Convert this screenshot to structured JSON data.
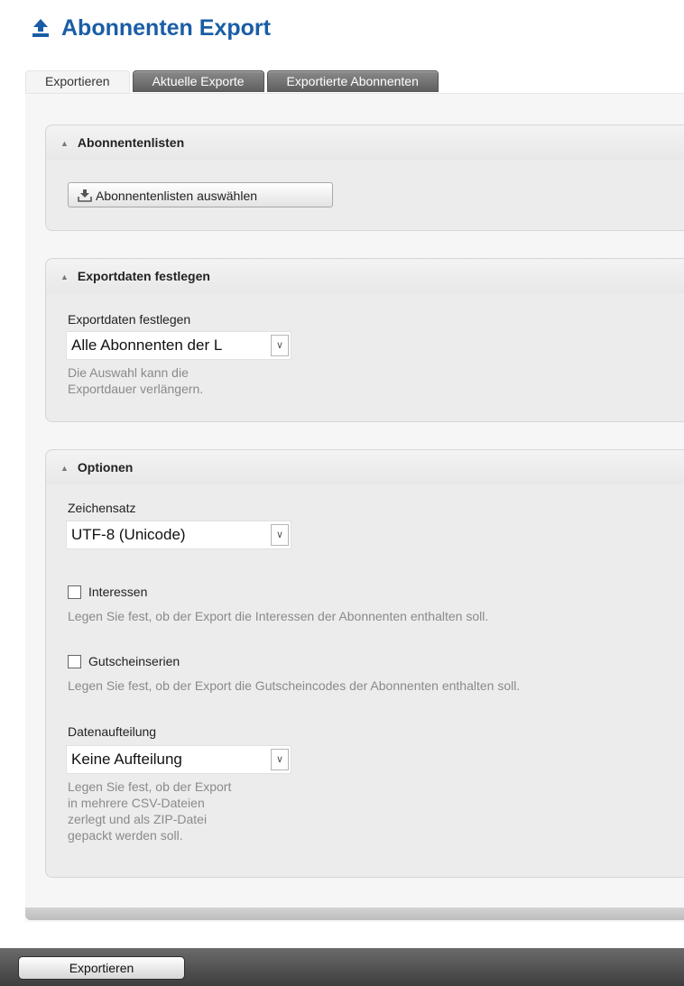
{
  "page": {
    "title": "Abonnenten Export",
    "title_icon": "upload-icon"
  },
  "tabs": [
    {
      "label": "Exportieren",
      "active": true
    },
    {
      "label": "Aktuelle Exporte",
      "active": false
    },
    {
      "label": "Exportierte Abonnenten",
      "active": false
    }
  ],
  "panels": {
    "lists": {
      "header": "Abonnentenlisten",
      "button_label": "Abonnentenlisten auswählen"
    },
    "exportdata": {
      "header": "Exportdaten festlegen",
      "field_label": "Exportdaten festlegen",
      "select_value": "Alle Abonnenten der L",
      "help_line1": "Die Auswahl kann die",
      "help_line2": "Exportdauer verlängern."
    },
    "options": {
      "header": "Optionen",
      "charset_label": "Zeichensatz",
      "charset_value": "UTF-8 (Unicode)",
      "interests_label": "Interessen",
      "interests_help": "Legen Sie fest, ob der Export die Interessen der Abonnenten enthalten soll.",
      "interests_checked": false,
      "vouchers_label": "Gutscheinserien",
      "vouchers_help": "Legen Sie fest, ob der Export die Gutscheincodes der Abonnenten enthalten soll.",
      "vouchers_checked": false,
      "split_label": "Datenaufteilung",
      "split_value": "Keine Aufteilung",
      "split_help_line1": "Legen Sie fest, ob der Export",
      "split_help_line2": "in mehrere CSV-Dateien",
      "split_help_line3": "zerlegt und als ZIP-Datei",
      "split_help_line4": "gepackt werden soll."
    }
  },
  "footer": {
    "export_button": "Exportieren"
  },
  "colors": {
    "title": "#1a5da6",
    "footer_bar": "#4a4a4a"
  }
}
